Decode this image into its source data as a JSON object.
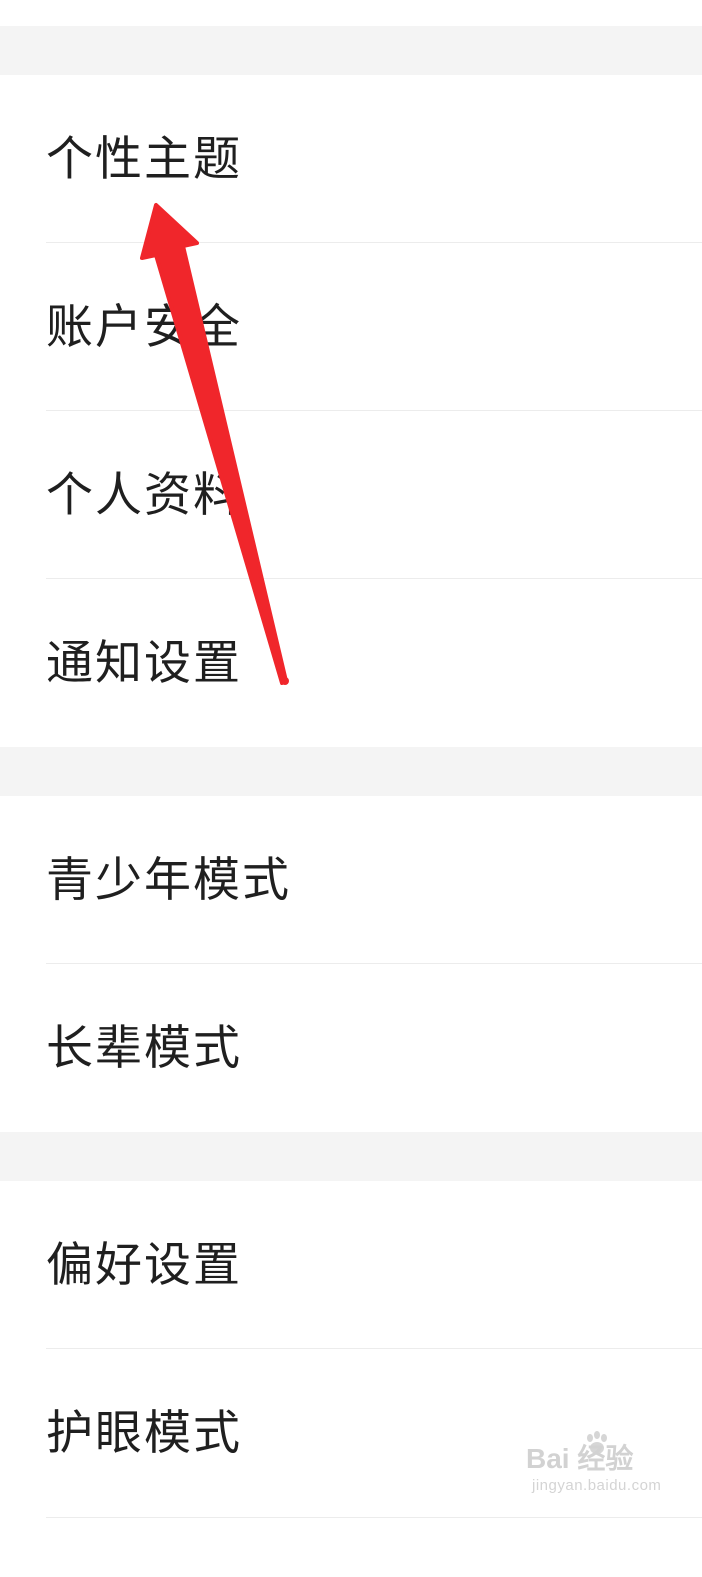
{
  "settings": {
    "group1": [
      {
        "label": "个性主题"
      },
      {
        "label": "账户安全"
      },
      {
        "label": "个人资料"
      },
      {
        "label": "通知设置"
      }
    ],
    "group2": [
      {
        "label": "青少年模式"
      },
      {
        "label": "长辈模式"
      }
    ],
    "group3": [
      {
        "label": "偏好设置"
      },
      {
        "label": "护眼模式"
      }
    ]
  },
  "annotation": {
    "arrow_color": "#f0262b",
    "points_to": "个性主题"
  },
  "watermark": {
    "brand": "Bai  经验",
    "url": "jingyan.baidu.com"
  }
}
